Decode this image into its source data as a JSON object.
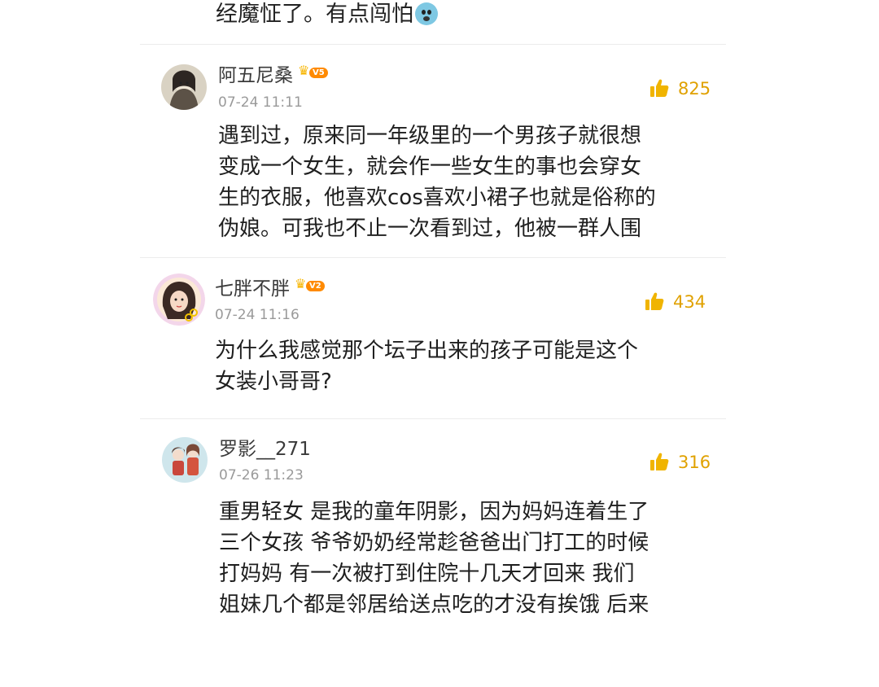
{
  "top_snippet": {
    "text": "经魔怔了。有点闯怕",
    "emoji_name": "fearful-face-icon"
  },
  "comments": [
    {
      "username": "阿五尼桑",
      "badge": {
        "level": "V5",
        "icon": "crown-icon"
      },
      "time": "07-24 11:11",
      "likes": "825",
      "lines": [
        "遇到过，原来同一年级里的一个男孩子就很想",
        "变成一个女生，就会作一些女生的事也会穿女",
        "生的衣服，他喜欢cos喜欢小裙子也就是俗称的",
        "伪娘。可我也不止一次看到过，他被一群人围"
      ]
    },
    {
      "username": "七胖不胖",
      "badge": {
        "level": "V2",
        "icon": "crown-icon"
      },
      "time": "07-24 11:16",
      "likes": "434",
      "lines": [
        "为什么我感觉那个坛子出来的孩子可能是这个",
        "女装小哥哥?"
      ]
    },
    {
      "username": "罗影__271",
      "time": "07-26 11:23",
      "likes": "316",
      "lines": [
        "重男轻女 是我的童年阴影，因为妈妈连着生了",
        "三个女孩 爷爷奶奶经常趁爸爸出门打工的时候",
        "打妈妈 有一次被打到住院十几天才回来 我们",
        "姐妹几个都是邻居给送点吃的才没有挨饿 后来"
      ]
    }
  ],
  "colors": {
    "like": "#e0a100",
    "username": "#3a3a3a",
    "time": "#9a9a9a",
    "badge": "#ff8a00"
  }
}
